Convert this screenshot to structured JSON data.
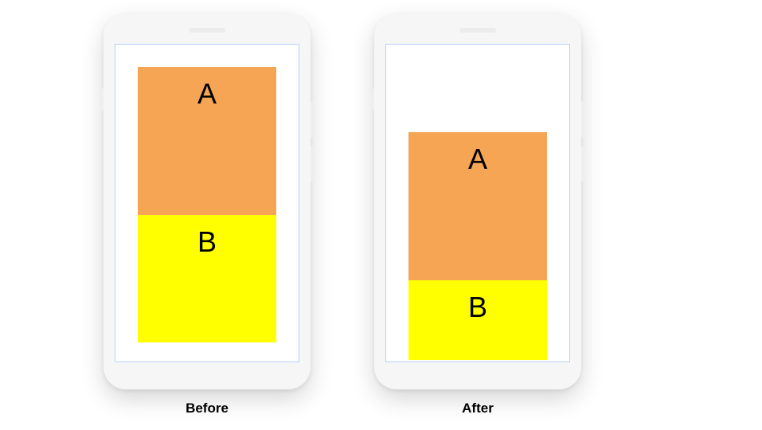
{
  "colors": {
    "block_a": "#f5a553",
    "block_b": "#ffff00",
    "screen_border": "#b9cffd",
    "phone_body": "#f6f6f6"
  },
  "phones": {
    "before": {
      "caption": "Before",
      "block_a_label": "A",
      "block_b_label": "B"
    },
    "after": {
      "caption": "After",
      "block_a_label": "A",
      "block_b_label": "B"
    }
  }
}
